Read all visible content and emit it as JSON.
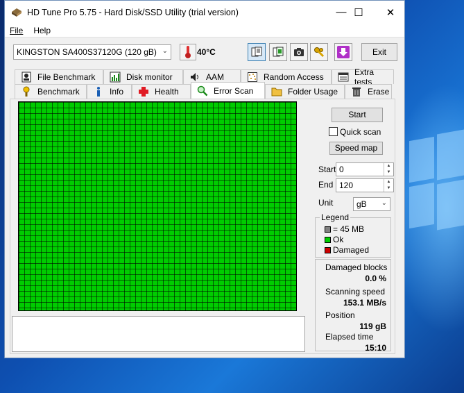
{
  "window": {
    "title": "HD Tune Pro 5.75 - Hard Disk/SSD Utility (trial version)",
    "minimize": "—",
    "maximize": "☐",
    "close": "✕"
  },
  "menu": {
    "file": "File",
    "help": "Help"
  },
  "toolbar": {
    "drive": "KINGSTON SA400S37120G (120 gB)",
    "temperature": "40°C",
    "exit_label": "Exit"
  },
  "tabs": {
    "row1": [
      "File Benchmark",
      "Disk monitor",
      "AAM",
      "Random Access",
      "Extra tests"
    ],
    "row2": [
      "Benchmark",
      "Info",
      "Health",
      "Error Scan",
      "Folder Usage",
      "Erase"
    ],
    "selected": "Error Scan"
  },
  "scan": {
    "start_button": "Start",
    "quick_scan_label": "Quick scan",
    "quick_scan_checked": false,
    "speed_map_button": "Speed map",
    "start_label": "Start",
    "start_value": "0",
    "end_label": "End",
    "end_value": "120",
    "unit_label": "Unit",
    "unit_value": "gB"
  },
  "legend": {
    "title": "Legend",
    "block_size": "= 45 MB",
    "ok": "Ok",
    "damaged": "Damaged",
    "colors": {
      "block": "#808080",
      "ok": "#00cc00",
      "damaged": "#cc0000"
    }
  },
  "stats": {
    "damaged_blocks_label": "Damaged blocks",
    "damaged_blocks_value": "0.0 %",
    "scanning_speed_label": "Scanning speed",
    "scanning_speed_value": "153.1 MB/s",
    "position_label": "Position",
    "position_value": "119 gB",
    "elapsed_time_label": "Elapsed time",
    "elapsed_time_value": "15:10"
  }
}
